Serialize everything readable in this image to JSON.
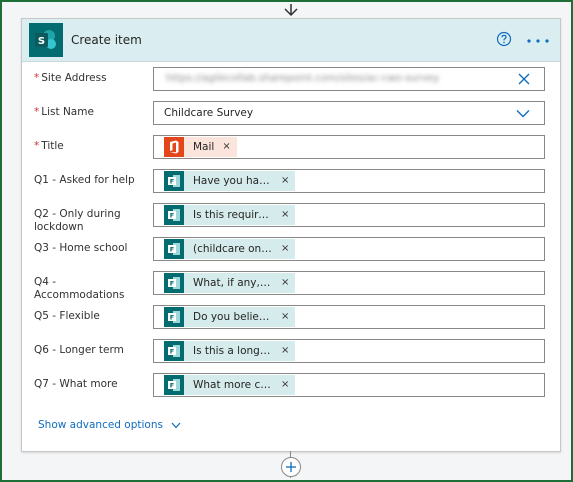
{
  "card": {
    "title": "Create item",
    "icon": "sharepoint-icon",
    "accent": "#036c70",
    "header_bg": "#daedf0"
  },
  "fields": {
    "site_address": {
      "label": "Site Address",
      "required": "*",
      "value": "https://agilecollab.sharepoint.com/sites/ac-cwo-survey"
    },
    "list_name": {
      "label": "List Name",
      "required": "*",
      "value": "Childcare Survey"
    },
    "title": {
      "label": "Title",
      "required": "*",
      "token": "Mail",
      "token_icon": "office-icon"
    },
    "q1": {
      "label": "Q1 - Asked for help",
      "token": "Have you had ..."
    },
    "q2": {
      "label": "Q2 - Only during lockdown",
      "token": "Is this require..."
    },
    "q3": {
      "label": "Q3 - Home school",
      "token": "(childcare only)..."
    },
    "q4": {
      "label": "Q4 - Accommodations",
      "token": "What, if any, ac..."
    },
    "q5": {
      "label": "Q5 - Flexible",
      "token": "Do you believe..."
    },
    "q6": {
      "label": "Q6 - Longer term",
      "token": "Is this a longer ..."
    },
    "q7": {
      "label": "Q7 - What more",
      "token": "What more can..."
    }
  },
  "token_remove": "×",
  "advanced_label": "Show advanced options",
  "colors": {
    "required": "#d13438",
    "link": "#0f6cbd",
    "frame": "#1e6f37"
  }
}
